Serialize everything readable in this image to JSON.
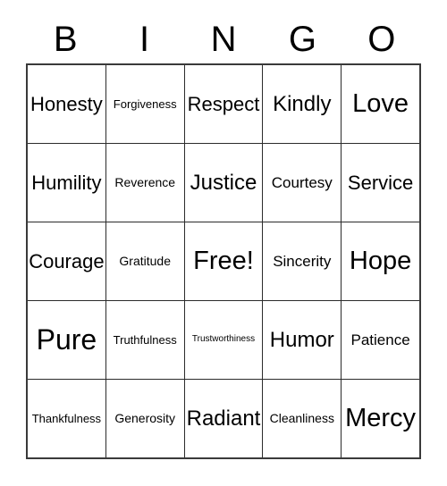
{
  "card": {
    "title": "BINGO",
    "header_letters": [
      "B",
      "I",
      "N",
      "G",
      "O"
    ],
    "free_space_label": "Free!",
    "colors": {
      "background": "#ffffff",
      "text": "#000000",
      "outer_border": "#3a3a3a",
      "inner_border": "#2b2b2b"
    },
    "rows": [
      [
        {
          "label": "Honesty",
          "size": "fs-md"
        },
        {
          "label": "Forgiveness",
          "size": "fs-xxs"
        },
        {
          "label": "Respect",
          "size": "fs-md"
        },
        {
          "label": "Kindly",
          "size": "fs-lg"
        },
        {
          "label": "Love",
          "size": "fs-xl"
        }
      ],
      [
        {
          "label": "Humility",
          "size": "fs-md"
        },
        {
          "label": "Reverence",
          "size": "fs-xs"
        },
        {
          "label": "Justice",
          "size": "fs-lg"
        },
        {
          "label": "Courtesy",
          "size": "fs-sm"
        },
        {
          "label": "Service",
          "size": "fs-md"
        }
      ],
      [
        {
          "label": "Courage",
          "size": "fs-md"
        },
        {
          "label": "Gratitude",
          "size": "fs-xs"
        },
        {
          "label": "Free!",
          "size": "fs-xl"
        },
        {
          "label": "Sincerity",
          "size": "fs-sm"
        },
        {
          "label": "Hope",
          "size": "fs-xl"
        }
      ],
      [
        {
          "label": "Pure",
          "size": "fs-xxl"
        },
        {
          "label": "Truthfulness",
          "size": "fs-xxs"
        },
        {
          "label": "Trustworthiness",
          "size": "fs-tiny"
        },
        {
          "label": "Humor",
          "size": "fs-lg"
        },
        {
          "label": "Patience",
          "size": "fs-sm"
        }
      ],
      [
        {
          "label": "Thankfulness",
          "size": "fs-xxs"
        },
        {
          "label": "Generosity",
          "size": "fs-xs"
        },
        {
          "label": "Radiant",
          "size": "fs-lg"
        },
        {
          "label": "Cleanliness",
          "size": "fs-xs"
        },
        {
          "label": "Mercy",
          "size": "fs-xl"
        }
      ]
    ]
  }
}
